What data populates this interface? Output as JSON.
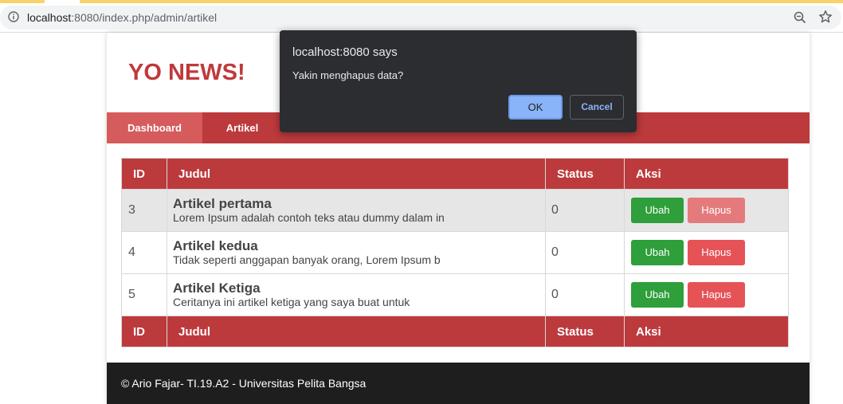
{
  "browser": {
    "url_host": "localhost",
    "url_rest": ":8080/index.php/admin/artikel"
  },
  "site": {
    "brand": "YO NEWS!"
  },
  "nav": {
    "items": [
      {
        "label": "Dashboard",
        "active": true
      },
      {
        "label": "Artikel",
        "active": false
      }
    ]
  },
  "table": {
    "headers": [
      "ID",
      "Judul",
      "Status",
      "Aksi"
    ],
    "rows": [
      {
        "id": "3",
        "title": "Artikel pertama",
        "excerpt": "Lorem Ipsum adalah contoh teks atau dummy dalam in",
        "status": "0",
        "edit": "Ubah",
        "delete": "Hapus"
      },
      {
        "id": "4",
        "title": "Artikel kedua",
        "excerpt": "Tidak seperti anggapan banyak orang, Lorem Ipsum b",
        "status": "0",
        "edit": "Ubah",
        "delete": "Hapus"
      },
      {
        "id": "5",
        "title": "Artikel Ketiga",
        "excerpt": "Ceritanya ini artikel ketiga yang saya buat untuk",
        "status": "0",
        "edit": "Ubah",
        "delete": "Hapus"
      }
    ]
  },
  "footer": {
    "text": "© Ario Fajar- TI.19.A2 - Universitas Pelita Bangsa"
  },
  "dialog": {
    "title": "localhost:8080 says",
    "message": "Yakin menghapus data?",
    "ok": "OK",
    "cancel": "Cancel"
  },
  "colors": {
    "brand": "#c0393b",
    "navbar": "#bd3a3c",
    "edit_button": "#2e9f3a",
    "delete_button": "#e55357",
    "footer": "#1e1e1e",
    "dialog_bg": "#2c2d31",
    "dialog_accent": "#8ab4f8"
  },
  "icons": [
    "info-icon",
    "zoom-out-icon",
    "star-icon"
  ]
}
